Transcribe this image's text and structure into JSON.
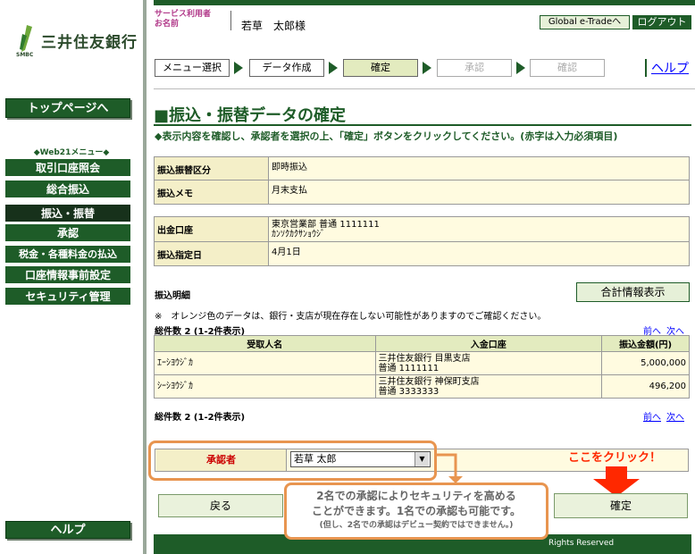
{
  "sidebar": {
    "logo_text": "三井住友銀行",
    "logo_sub": "SMBC",
    "top_button": "トップページへ",
    "menu_heading": "◆Web21メニュー◆",
    "menu_items": [
      {
        "label": "取引口座照会"
      },
      {
        "label": "総合振込"
      },
      {
        "label": "振込・振替"
      },
      {
        "label": "承認"
      },
      {
        "label": "税金・各種料金の払込"
      },
      {
        "label": "口座情報事前設定"
      },
      {
        "label": "セキュリティ管理"
      }
    ],
    "help_button": "ヘルプ"
  },
  "header": {
    "user_caption_1": "サービス利用者",
    "user_caption_2": "お名前",
    "user_name": "若草　太郎様",
    "global_button": "Global e-Tradeへ",
    "logout_button": "ログアウト",
    "help_link": "ヘルプ"
  },
  "steps": [
    "メニュー選択",
    "データ作成",
    "確定",
    "承認",
    "確認"
  ],
  "main": {
    "title": "■振込・振替データの確定",
    "instruction": "◆表示内容を確認し、承認者を選択の上、「確定」ボタンをクリックしてください。(赤字は入力必須項目)",
    "info1": [
      {
        "key": "振込振替区分",
        "value": "即時振込"
      },
      {
        "key": "振込メモ",
        "value": "月末支払"
      }
    ],
    "info2": [
      {
        "key": "出金口座",
        "value1": "東京営業部 普通 1111111",
        "value2": "ｶﾝｿｸｶｸｻﾝｮｳｼﾞ"
      },
      {
        "key": "振込指定日",
        "value1": "4月1日",
        "value2": ""
      }
    ],
    "detail_label": "振込明細",
    "total_button": "合計情報表示",
    "note": "※　オレンジ色のデータは、銀行・支店が現在存在しない可能性がありますのでご確認ください。",
    "count_text": "総件数 2 (1-2件表示)",
    "pager_prev": "前へ",
    "pager_next": "次へ",
    "table": {
      "headers": [
        "受取人名",
        "入金口座",
        "振込金額(円)"
      ],
      "rows": [
        {
          "name": "ｴｰｼﾖｳｼﾞｶ",
          "account1": "三井住友銀行 目黒支店",
          "account2": "普通 1111111",
          "amount": "5,000,000"
        },
        {
          "name": "ｼｰｼﾖｳｼﾞｶ",
          "account1": "三井住友銀行 神保町支店",
          "account2": "普通 3333333",
          "amount": "496,200"
        }
      ]
    },
    "approver_label": "承認者",
    "approver_value": "若草 太郎",
    "click_here": "ここをクリック！",
    "back_button": "戻る",
    "confirm_button": "確定",
    "callout_line1": "2名での承認によりセキュリティを高める",
    "callout_line2": "ことができます。1名での承認も可能です。",
    "callout_line3": "(但し、2名での承認はデビュー契約ではできません。)",
    "copyright": "Rights Reserved"
  },
  "colors": {
    "brand_green": "#1e5c28",
    "highlight_orange": "#e89550",
    "alert_red": "#ff2800"
  }
}
